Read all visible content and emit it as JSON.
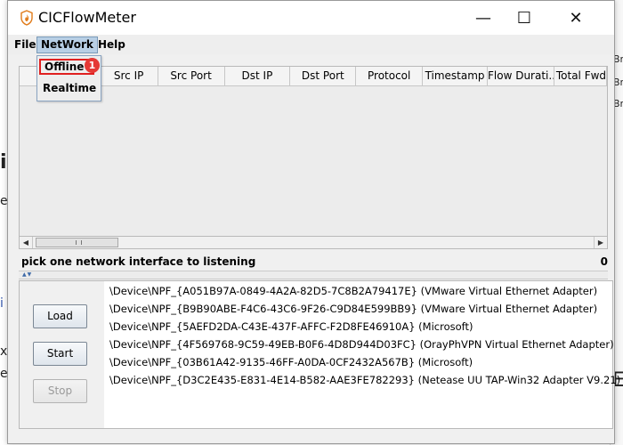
{
  "window": {
    "title": "CICFlowMeter"
  },
  "titlebar": {
    "minimize": "—",
    "maximize": "☐",
    "close": "✕"
  },
  "menu": {
    "file": "File",
    "network": "NetWork",
    "help": "Help"
  },
  "network_menu": {
    "items": [
      "Offline",
      "Realtime"
    ],
    "badge": "1"
  },
  "table": {
    "columns": [
      "",
      "Src IP",
      "Src Port",
      "Dst IP",
      "Dst Port",
      "Protocol",
      "Timestamp",
      "Flow Durati...",
      "Total Fwd P"
    ]
  },
  "status": {
    "text": "pick one network interface to listening",
    "count": "0"
  },
  "buttons": {
    "load": "Load",
    "start": "Start",
    "stop": "Stop"
  },
  "interfaces": [
    "\\Device\\NPF_{A051B97A-0849-4A2A-82D5-7C8B2A79417E} (VMware Virtual Ethernet Adapter)",
    "\\Device\\NPF_{B9B90ABE-F4C6-43C6-9F26-C9D84E599BB9} (VMware Virtual Ethernet Adapter)",
    "\\Device\\NPF_{5AEFD2DA-C43E-437F-AFFC-F2D8FE46910A} (Microsoft)",
    "\\Device\\NPF_{4F569768-9C59-49EB-B0F6-4D8D944D03FC} (OrayPhVPN Virtual Ethernet Adapter)",
    "\\Device\\NPF_{03B61A42-9135-46FF-A0DA-0CF2432A567B} (Microsoft)",
    "\\Device\\NPF_{D3C2E435-E831-4E14-B582-AAE3FE782293} (Netease UU TAP-Win32 Adapter V9.21)"
  ],
  "colors": {
    "menu_active": "#b8cfe5",
    "highlight_box": "#e02020",
    "badge": "#e53935"
  }
}
